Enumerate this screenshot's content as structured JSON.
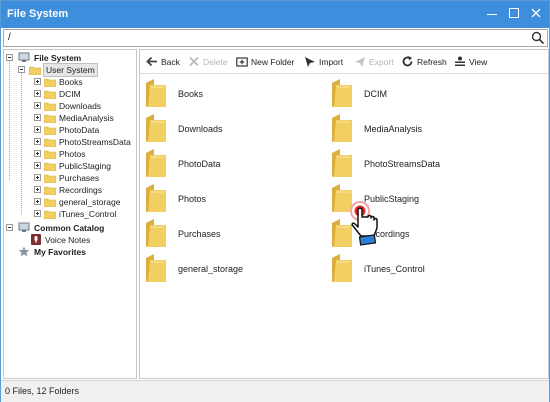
{
  "window": {
    "title": "File System"
  },
  "path": {
    "value": "/"
  },
  "tree": {
    "root": "File System",
    "user_system": "User System",
    "folders": [
      "Books",
      "DCIM",
      "Downloads",
      "MediaAnalysis",
      "PhotoData",
      "PhotoStreamsData",
      "Photos",
      "PublicStaging",
      "Purchases",
      "Recordings",
      "general_storage",
      "iTunes_Control"
    ],
    "common_catalog": "Common Catalog",
    "voice_notes": "Voice Notes",
    "my_favorites": "My Favorites"
  },
  "toolbar": {
    "back": "Back",
    "delete": "Delete",
    "new_folder": "New Folder",
    "import": "Import",
    "export": "Export",
    "refresh": "Refresh",
    "view": "View"
  },
  "grid": {
    "items": [
      "Books",
      "DCIM",
      "Downloads",
      "MediaAnalysis",
      "PhotoData",
      "PhotoStreamsData",
      "Photos",
      "PublicStaging",
      "Purchases",
      "Recordings",
      "general_storage",
      "iTunes_Control"
    ]
  },
  "status": {
    "text": "0 Files, 12 Folders"
  },
  "colors": {
    "titlebar": "#3d8fde",
    "folder": "#f2cf63",
    "folder_dark": "#dcae3e",
    "cursor_ring": "#e8252b"
  },
  "icons": {
    "search": "search-icon",
    "folder": "folder-icon",
    "computer": "computer-icon",
    "star": "star-icon",
    "hand": "hand-cursor-icon"
  }
}
